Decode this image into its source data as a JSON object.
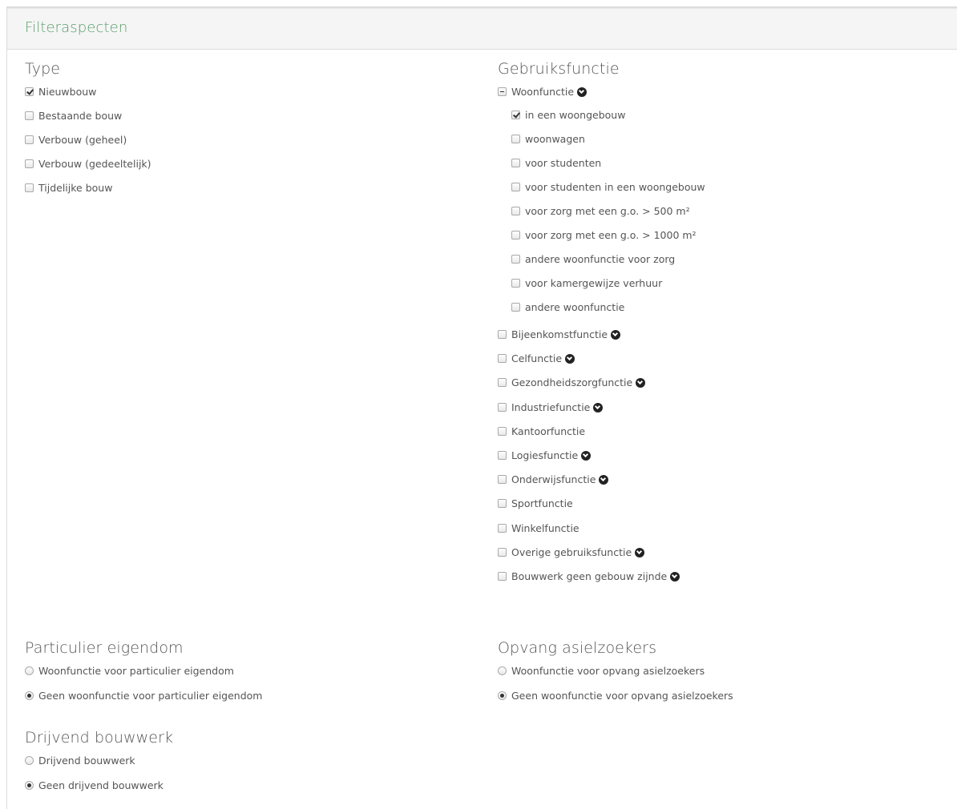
{
  "header": {
    "title": "Filteraspecten"
  },
  "type": {
    "title": "Type",
    "options": [
      {
        "label": "Nieuwbouw",
        "checked": true
      },
      {
        "label": "Bestaande bouw",
        "checked": false
      },
      {
        "label": "Verbouw (geheel)",
        "checked": false
      },
      {
        "label": "Verbouw (gedeeltelijk)",
        "checked": false
      },
      {
        "label": "Tijdelijke bouw",
        "checked": false
      }
    ]
  },
  "gebruiksfunctie": {
    "title": "Gebruiksfunctie",
    "woonfunctie": {
      "label": "Woonfunctie",
      "state": "indeterminate",
      "sub": [
        {
          "label": "in een woongebouw",
          "checked": true
        },
        {
          "label": "woonwagen",
          "checked": false
        },
        {
          "label": "voor studenten",
          "checked": false
        },
        {
          "label": "voor studenten in een woongebouw",
          "checked": false
        },
        {
          "label": "voor zorg met een g.o. > 500 m²",
          "checked": false
        },
        {
          "label": "voor zorg met een g.o. > 1000 m²",
          "checked": false
        },
        {
          "label": "andere woonfunctie voor zorg",
          "checked": false
        },
        {
          "label": "voor kamergewijze verhuur",
          "checked": false
        },
        {
          "label": "andere woonfunctie",
          "checked": false
        }
      ]
    },
    "others": [
      {
        "label": "Bijeenkomstfunctie",
        "expandable": true
      },
      {
        "label": "Celfunctie",
        "expandable": true
      },
      {
        "label": "Gezondheidszorgfunctie",
        "expandable": true
      },
      {
        "label": "Industriefunctie",
        "expandable": true
      },
      {
        "label": "Kantoorfunctie",
        "expandable": false
      },
      {
        "label": "Logiesfunctie",
        "expandable": true
      },
      {
        "label": "Onderwijsfunctie",
        "expandable": true
      },
      {
        "label": "Sportfunctie",
        "expandable": false
      },
      {
        "label": "Winkelfunctie",
        "expandable": false
      },
      {
        "label": "Overige gebruiksfunctie",
        "expandable": true
      },
      {
        "label": "Bouwwerk geen gebouw zijnde",
        "expandable": true
      }
    ]
  },
  "particulier": {
    "title": "Particulier eigendom",
    "options": [
      {
        "label": "Woonfunctie voor particulier eigendom",
        "selected": false
      },
      {
        "label": "Geen woonfunctie voor particulier eigendom",
        "selected": true
      }
    ]
  },
  "asiel": {
    "title": "Opvang asielzoekers",
    "options": [
      {
        "label": "Woonfunctie voor opvang asielzoekers",
        "selected": false
      },
      {
        "label": "Geen woonfunctie voor opvang asielzoekers",
        "selected": true
      }
    ]
  },
  "drijvend": {
    "title": "Drijvend bouwwerk",
    "options": [
      {
        "label": "Drijvend bouwwerk",
        "selected": false
      },
      {
        "label": "Geen drijvend bouwwerk",
        "selected": true
      }
    ]
  }
}
